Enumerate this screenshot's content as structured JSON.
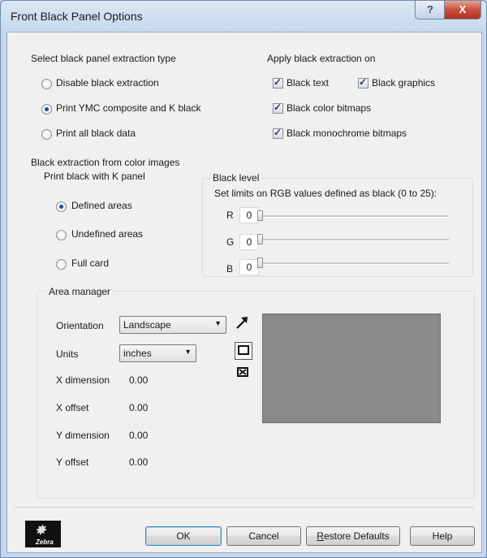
{
  "window": {
    "title": "Front Black Panel Options",
    "help_button": "?",
    "close_button": "X"
  },
  "extraction_type": {
    "heading": "Select black panel extraction type",
    "options": [
      {
        "label": "Disable black extraction",
        "selected": false
      },
      {
        "label": "Print YMC composite and K black",
        "selected": true
      },
      {
        "label": "Print all black data",
        "selected": false
      }
    ]
  },
  "apply_on": {
    "heading": "Apply black extraction on",
    "black_text": {
      "label": "Black text",
      "checked": true
    },
    "black_graphics": {
      "label": "Black graphics",
      "checked": true
    },
    "black_color_bitmaps": {
      "label": "Black color bitmaps",
      "checked": true
    },
    "black_monochrome_bitmaps": {
      "label": "Black monochrome bitmaps",
      "checked": true
    }
  },
  "color_images": {
    "heading": "Black extraction from color images",
    "k_panel": {
      "heading": "Print black with K panel",
      "options": [
        {
          "label": "Defined areas",
          "selected": true
        },
        {
          "label": "Undefined areas",
          "selected": false
        },
        {
          "label": "Full card",
          "selected": false
        }
      ]
    },
    "black_level": {
      "heading": "Black level",
      "description": "Set limits on RGB values defined as black (0 to 25):",
      "channels": [
        {
          "label": "R",
          "value": "0"
        },
        {
          "label": "G",
          "value": "0"
        },
        {
          "label": "B",
          "value": "0"
        }
      ]
    }
  },
  "area_manager": {
    "heading": "Area manager",
    "orientation": {
      "label": "Orientation",
      "value": "Landscape"
    },
    "units": {
      "label": "Units",
      "value": "inches"
    },
    "x_dimension": {
      "label": "X dimension",
      "value": "0.00"
    },
    "x_offset": {
      "label": "X offset",
      "value": "0.00"
    },
    "y_dimension": {
      "label": "Y dimension",
      "value": "0.00"
    },
    "y_offset": {
      "label": "Y offset",
      "value": "0.00"
    },
    "tools": [
      "arrow-pointer-icon",
      "rectangle-tool-icon",
      "delete-area-icon"
    ],
    "preview_color": "#8a8a8a"
  },
  "footer": {
    "logo_text": "Zebra",
    "ok": "OK",
    "cancel": "Cancel",
    "restore_first": "R",
    "restore_rest": "estore Defaults",
    "help": "Help"
  }
}
